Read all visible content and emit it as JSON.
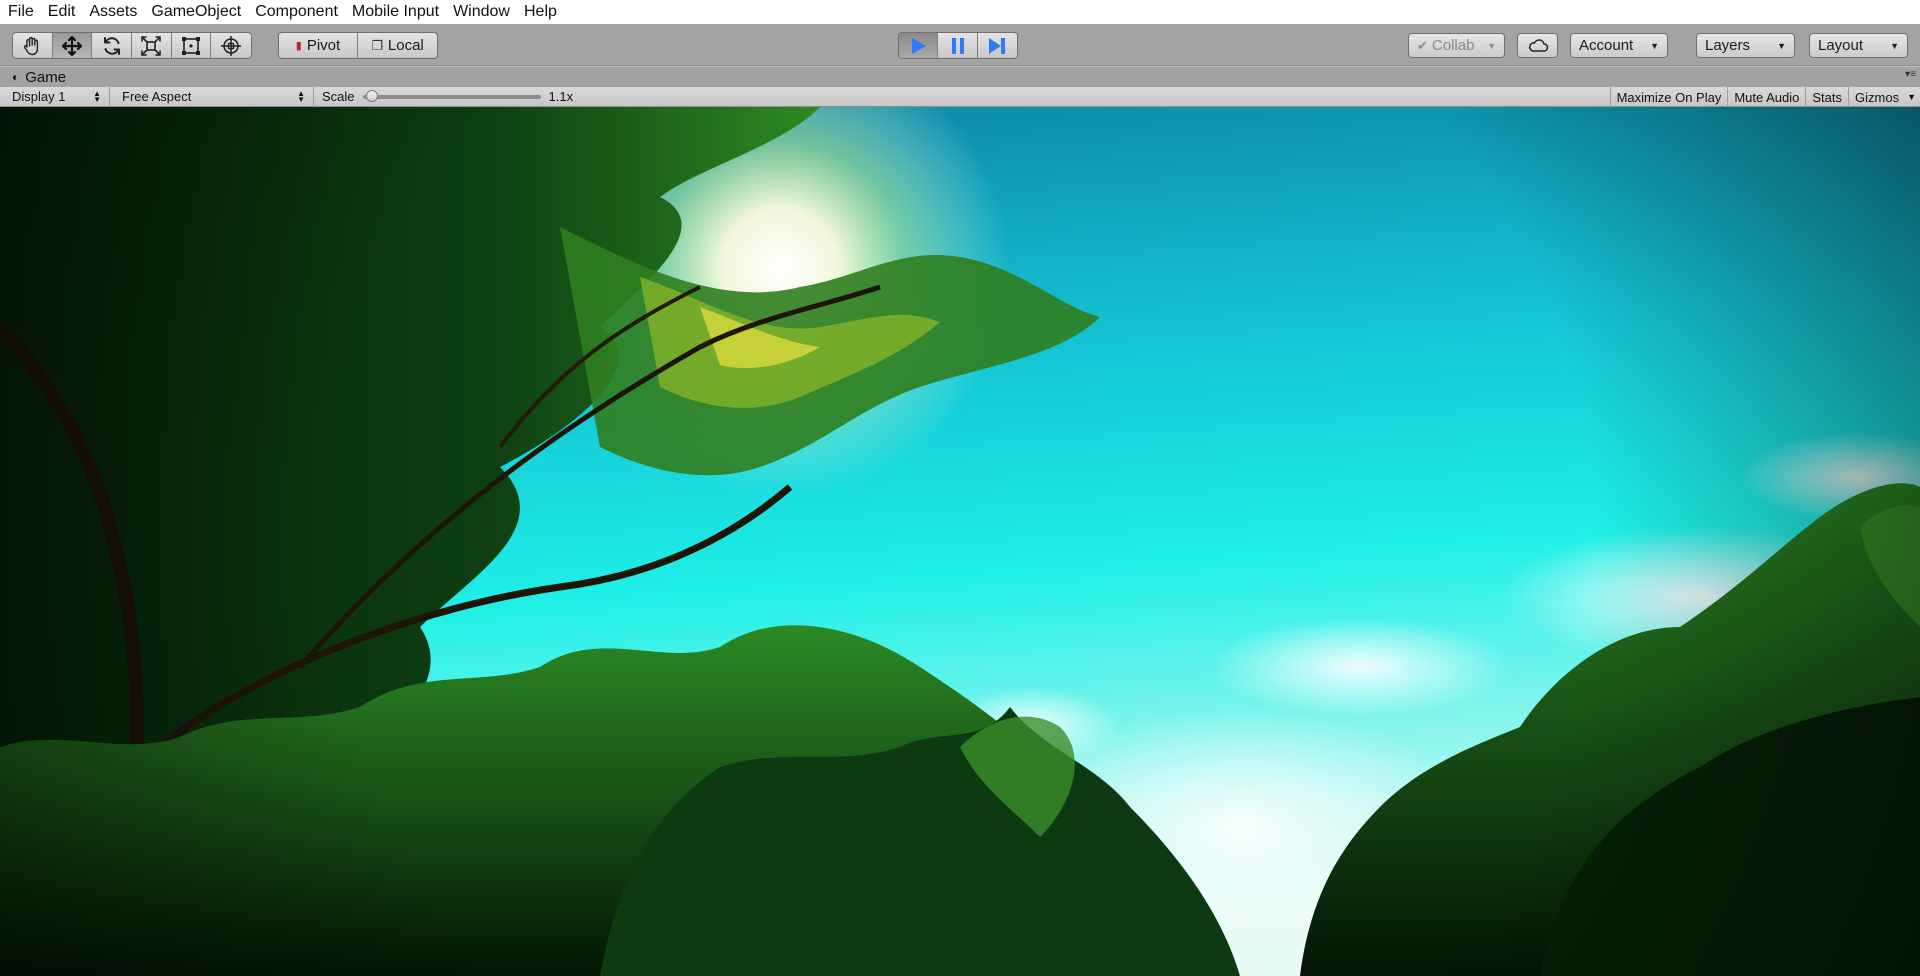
{
  "menu": {
    "items": [
      "File",
      "Edit",
      "Assets",
      "GameObject",
      "Component",
      "Mobile Input",
      "Window",
      "Help"
    ]
  },
  "toolbar": {
    "transform_tools": [
      {
        "name": "hand-tool",
        "icon": "hand-icon"
      },
      {
        "name": "move-tool",
        "icon": "move-arrows-icon"
      },
      {
        "name": "rotate-tool",
        "icon": "rotate-icon"
      },
      {
        "name": "scale-tool",
        "icon": "scale-icon"
      },
      {
        "name": "rect-tool",
        "icon": "rect-tool-icon"
      },
      {
        "name": "transform-tool",
        "icon": "transform-icon"
      }
    ],
    "pivot_label": "Pivot",
    "local_label": "Local",
    "play": {
      "play_icon": "play-icon",
      "pause_icon": "pause-icon",
      "step_icon": "step-icon",
      "state": "playing",
      "accent": "#2f7bf5"
    },
    "collab_label": "Collab",
    "account_label": "Account",
    "layers_label": "Layers",
    "layout_label": "Layout"
  },
  "game_tab": {
    "title": "Game"
  },
  "game_bar": {
    "display": "Display 1",
    "aspect": "Free Aspect",
    "scale_label": "Scale",
    "scale_value": "1.1x",
    "maximize_on_play": "Maximize On Play",
    "mute_audio": "Mute Audio",
    "stats": "Stats",
    "gizmos": "Gizmos"
  },
  "scene": {
    "description_colors": {
      "sky_top": "#0f8fb0",
      "sky_mid": "#1fe0e0",
      "sun": "#fffbe0",
      "foliage_dark": "#0a3a10",
      "foliage_light": "#2a8a20"
    }
  }
}
